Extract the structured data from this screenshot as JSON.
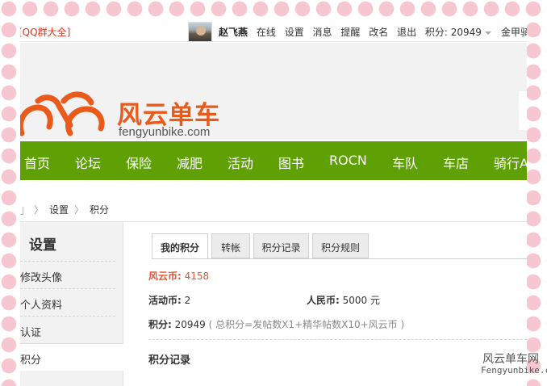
{
  "topbar": {
    "qq_link": "[QQ群大全]",
    "username": "赵飞燕",
    "links": [
      "在线",
      "设置",
      "消息",
      "提醒",
      "改名",
      "退出"
    ],
    "points_label": "积分: 20949",
    "rank": "金甲骑士"
  },
  "header": {
    "logo_cn": "风云单车",
    "logo_en": "fengyunbike.com"
  },
  "nav": {
    "items": [
      "首页",
      "论坛",
      "保险",
      "减肥",
      "活动",
      "图书",
      "ROCN",
      "车队",
      "车店",
      "骑行A"
    ]
  },
  "breadcrumb": {
    "items": [
      "设置",
      "积分"
    ]
  },
  "sidebar": {
    "title": "设置",
    "items": [
      "修改头像",
      "个人资料",
      "认证",
      "积分"
    ]
  },
  "tabs": [
    "我的积分",
    "转帐",
    "积分记录",
    "积分规则"
  ],
  "credits": {
    "fyb_label": "风云币:",
    "fyb_value": "4158",
    "activity_label": "活动币:",
    "activity_value": "2",
    "rmb_label": "人民币:",
    "rmb_value": "5000 元",
    "points_label": "积分:",
    "points_value": "20949",
    "points_formula": "( 总积分=发帖数X1+精华帖数X10+风云币 )"
  },
  "section_title": "积分记录",
  "watermark": {
    "cn": "风云单车网",
    "en": "Fengyunbike.com"
  },
  "colors": {
    "brand_orange": "#ea5a1a",
    "nav_green": "#5fa005",
    "highlight_red": "#e2552e"
  }
}
